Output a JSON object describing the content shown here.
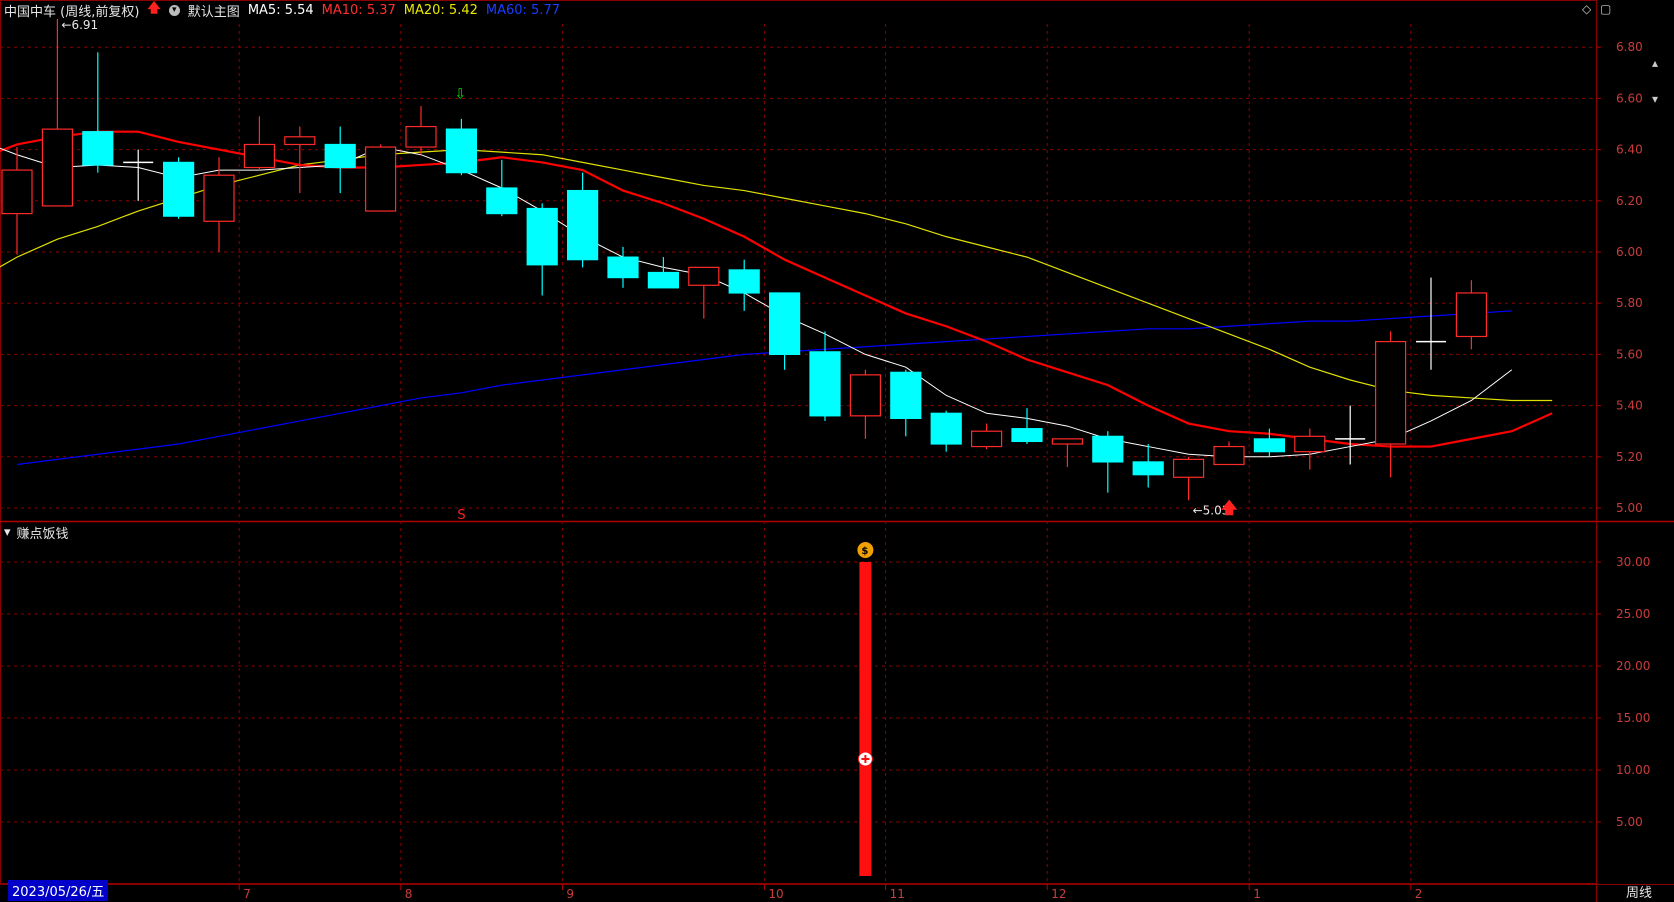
{
  "header": {
    "stock_title": "中国中车 (周线,前复权)",
    "template_label": "默认主图",
    "ma5": "MA5: 5.54",
    "ma10": "MA10: 5.37",
    "ma20": "MA20: 5.42",
    "ma60": "MA60: 5.77"
  },
  "colors": {
    "up": "#ff2a2a",
    "down": "#00ffff",
    "ma5": "#ffffff",
    "ma10": "#ff0000",
    "ma20": "#e0e000",
    "ma60": "#0000ff",
    "grid": "#8b0000"
  },
  "sub_indicator": {
    "title": "赚点饭钱"
  },
  "date_label": "2023/05/26/五",
  "period_label": "周线",
  "signals": {
    "sell_marker": "S",
    "coin_icon": "money-bag-icon",
    "plus_icon": "plus-circle-icon"
  },
  "chart_data": [
    {
      "type": "candlestick",
      "price_axis": {
        "min": 5.0,
        "max": 6.9,
        "ticks": [
          "6.80",
          "6.60",
          "6.40",
          "6.20",
          "6.00",
          "5.80",
          "5.60",
          "5.40",
          "5.20",
          "5.00"
        ]
      },
      "x_tick_labels": [
        {
          "index": 6,
          "label": "7"
        },
        {
          "index": 10,
          "label": "8"
        },
        {
          "index": 14,
          "label": "9"
        },
        {
          "index": 19,
          "label": "10"
        },
        {
          "index": 22,
          "label": "11"
        },
        {
          "index": 26,
          "label": "12"
        },
        {
          "index": 31,
          "label": "1"
        },
        {
          "index": 35,
          "label": "2"
        }
      ],
      "candles": [
        {
          "o": 6.15,
          "h": 6.41,
          "l": 5.99,
          "c": 6.32
        },
        {
          "o": 6.18,
          "h": 6.91,
          "l": 6.18,
          "c": 6.48
        },
        {
          "o": 6.47,
          "h": 6.78,
          "l": 6.31,
          "c": 6.34
        },
        {
          "o": 6.35,
          "h": 6.4,
          "l": 6.2,
          "c": 6.35
        },
        {
          "o": 6.35,
          "h": 6.37,
          "l": 6.13,
          "c": 6.14
        },
        {
          "o": 6.12,
          "h": 6.37,
          "l": 6.0,
          "c": 6.3
        },
        {
          "o": 6.33,
          "h": 6.53,
          "l": 6.32,
          "c": 6.42
        },
        {
          "o": 6.42,
          "h": 6.49,
          "l": 6.23,
          "c": 6.45
        },
        {
          "o": 6.42,
          "h": 6.49,
          "l": 6.23,
          "c": 6.33
        },
        {
          "o": 6.16,
          "h": 6.42,
          "l": 6.16,
          "c": 6.41
        },
        {
          "o": 6.41,
          "h": 6.57,
          "l": 6.38,
          "c": 6.49
        },
        {
          "o": 6.48,
          "h": 6.52,
          "l": 6.3,
          "c": 6.31
        },
        {
          "o": 6.25,
          "h": 6.36,
          "l": 6.14,
          "c": 6.15
        },
        {
          "o": 6.17,
          "h": 6.19,
          "l": 5.83,
          "c": 5.95
        },
        {
          "o": 6.24,
          "h": 6.31,
          "l": 5.94,
          "c": 5.97
        },
        {
          "o": 5.98,
          "h": 6.02,
          "l": 5.86,
          "c": 5.9
        },
        {
          "o": 5.92,
          "h": 5.98,
          "l": 5.86,
          "c": 5.86
        },
        {
          "o": 5.87,
          "h": 5.93,
          "l": 5.74,
          "c": 5.94
        },
        {
          "o": 5.93,
          "h": 5.97,
          "l": 5.77,
          "c": 5.84
        },
        {
          "o": 5.84,
          "h": 5.84,
          "l": 5.54,
          "c": 5.6
        },
        {
          "o": 5.61,
          "h": 5.69,
          "l": 5.34,
          "c": 5.36
        },
        {
          "o": 5.36,
          "h": 5.54,
          "l": 5.27,
          "c": 5.52
        },
        {
          "o": 5.53,
          "h": 5.54,
          "l": 5.28,
          "c": 5.35
        },
        {
          "o": 5.37,
          "h": 5.38,
          "l": 5.22,
          "c": 5.25
        },
        {
          "o": 5.24,
          "h": 5.33,
          "l": 5.23,
          "c": 5.3
        },
        {
          "o": 5.31,
          "h": 5.39,
          "l": 5.25,
          "c": 5.26
        },
        {
          "o": 5.25,
          "h": 5.27,
          "l": 5.16,
          "c": 5.27
        },
        {
          "o": 5.28,
          "h": 5.3,
          "l": 5.06,
          "c": 5.18
        },
        {
          "o": 5.18,
          "h": 5.25,
          "l": 5.08,
          "c": 5.13
        },
        {
          "o": 5.12,
          "h": 5.2,
          "l": 5.03,
          "c": 5.19
        },
        {
          "o": 5.17,
          "h": 5.26,
          "l": 5.17,
          "c": 5.24
        },
        {
          "o": 5.27,
          "h": 5.31,
          "l": 5.2,
          "c": 5.22
        },
        {
          "o": 5.22,
          "h": 5.31,
          "l": 5.15,
          "c": 5.28
        },
        {
          "o": 5.27,
          "h": 5.4,
          "l": 5.17,
          "c": 5.27
        },
        {
          "o": 5.25,
          "h": 5.69,
          "l": 5.12,
          "c": 5.65
        },
        {
          "o": 5.65,
          "h": 5.9,
          "l": 5.54,
          "c": 5.65
        },
        {
          "o": 5.67,
          "h": 5.89,
          "l": 5.62,
          "c": 5.84
        }
      ],
      "ma5": [
        6.44,
        6.38,
        6.33,
        6.34,
        6.33,
        6.29,
        6.32,
        6.32,
        6.33,
        6.34,
        6.41,
        6.38,
        6.32,
        6.25,
        6.16,
        6.06,
        5.98,
        5.94,
        5.91,
        5.84,
        5.75,
        5.68,
        5.6,
        5.55,
        5.44,
        5.37,
        5.35,
        5.32,
        5.27,
        5.24,
        5.21,
        5.2,
        5.2,
        5.21,
        5.24,
        5.27,
        5.34,
        5.42,
        5.54
      ],
      "ma10": [
        6.36,
        6.42,
        6.45,
        6.47,
        6.47,
        6.43,
        6.4,
        6.37,
        6.34,
        6.33,
        6.33,
        6.34,
        6.35,
        6.37,
        6.35,
        6.32,
        6.24,
        6.19,
        6.13,
        6.06,
        5.97,
        5.9,
        5.83,
        5.76,
        5.71,
        5.65,
        5.58,
        5.53,
        5.48,
        5.4,
        5.33,
        5.3,
        5.29,
        5.27,
        5.25,
        5.24,
        5.24,
        5.27,
        5.3,
        5.37
      ],
      "ma20": [
        5.89,
        5.98,
        6.05,
        6.1,
        6.16,
        6.21,
        6.26,
        6.3,
        6.34,
        6.36,
        6.38,
        6.39,
        6.4,
        6.39,
        6.38,
        6.35,
        6.32,
        6.29,
        6.26,
        6.24,
        6.21,
        6.18,
        6.15,
        6.11,
        6.06,
        6.02,
        5.98,
        5.92,
        5.86,
        5.8,
        5.74,
        5.68,
        5.62,
        5.55,
        5.5,
        5.46,
        5.44,
        5.43,
        5.42,
        5.42
      ],
      "ma60": [
        5.17,
        5.19,
        5.21,
        5.23,
        5.25,
        5.28,
        5.31,
        5.34,
        5.37,
        5.4,
        5.43,
        5.45,
        5.48,
        5.5,
        5.52,
        5.54,
        5.56,
        5.58,
        5.6,
        5.61,
        5.62,
        5.63,
        5.64,
        5.65,
        5.66,
        5.67,
        5.68,
        5.69,
        5.7,
        5.7,
        5.71,
        5.72,
        5.73,
        5.73,
        5.74,
        5.75,
        5.76,
        5.77
      ],
      "annotations": [
        {
          "label": "6.91",
          "index": 1,
          "price": 6.91
        },
        {
          "label": "5.03",
          "index": 29,
          "price": 5.03
        }
      ]
    },
    {
      "type": "bar",
      "title": "赚点饭钱",
      "y_axis": {
        "min": 0,
        "max": 33,
        "ticks": [
          "30.00",
          "25.00",
          "20.00",
          "15.00",
          "10.00",
          "5.00"
        ]
      },
      "bars": [
        {
          "index": 21,
          "value": 30.0
        }
      ]
    }
  ]
}
